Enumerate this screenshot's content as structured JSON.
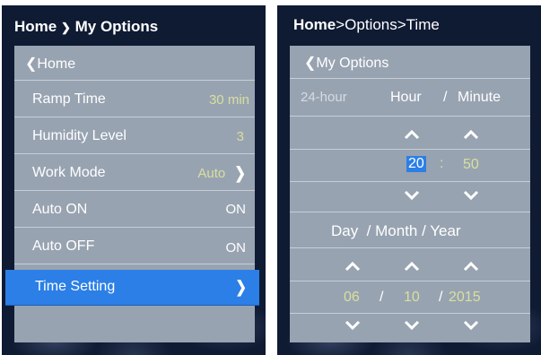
{
  "left_screen": {
    "title_home": "Home",
    "title_sep": "❯",
    "title_page": "My Options",
    "back_label": "❮Home",
    "items": [
      {
        "label": "Ramp Time",
        "value": "30 min"
      },
      {
        "label": "Humidity Level",
        "value": "3"
      },
      {
        "label": "Work Mode",
        "value": "Auto"
      },
      {
        "label": "Auto  ON",
        "value": "ON"
      },
      {
        "label": "Auto  OFF",
        "value": "ON"
      },
      {
        "label": "Time Setting",
        "value": ""
      }
    ],
    "chevron": "❯"
  },
  "right_screen": {
    "title_home": "Home",
    "title_rest": ">Options>Time",
    "back_label": "❮My Options",
    "hour_format": "24-hour",
    "hour_minute_label_a": "Hour",
    "hour_minute_label_sep": "/",
    "hour_minute_label_b": "Minute",
    "hour": "20",
    "time_sep": ":",
    "minute": "50",
    "date_label": "Day  / Month / Year",
    "day": "06",
    "date_sep1": "/",
    "month": "10",
    "date_sep2": "/",
    "year": "2015"
  },
  "colors": {
    "background": "#0f1a33",
    "panel": "#98a3b1",
    "highlight": "#2b7fe6",
    "value_text": "#d9df9e"
  }
}
